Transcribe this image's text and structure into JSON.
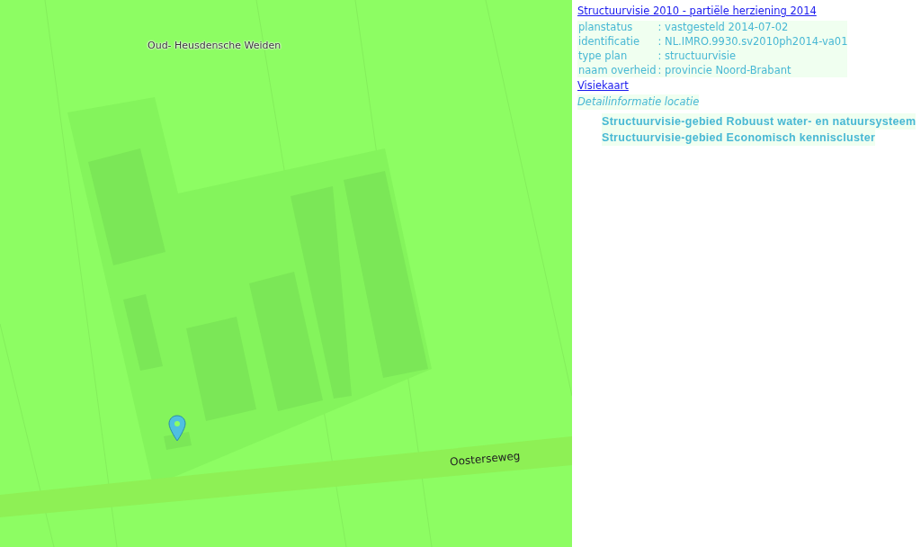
{
  "map": {
    "labels": [
      {
        "kind": "place",
        "text": "Oud- Heusdensche Weiden"
      },
      {
        "kind": "road",
        "text": "Oosterseweg"
      }
    ]
  },
  "plan": {
    "title": "Structuurvisie 2010 - partiële herziening 2014",
    "fields": [
      {
        "label": "planstatus",
        "value": ": vastgesteld 2014-07-02"
      },
      {
        "label": "identificatie",
        "value": ": NL.IMRO.9930.sv2010ph2014-va01"
      },
      {
        "label": "type plan",
        "value": ": structuurvisie"
      },
      {
        "label": "naam overheid",
        "value": ": provincie Noord-Brabant"
      }
    ],
    "map_link": "Visiekaart",
    "detail_heading": "Detailinformatie locatie",
    "details": [
      "Structuurvisie-gebied Robuust water- en natuursysteem",
      "Structuurvisie-gebied Economisch kenniscluster"
    ]
  }
}
